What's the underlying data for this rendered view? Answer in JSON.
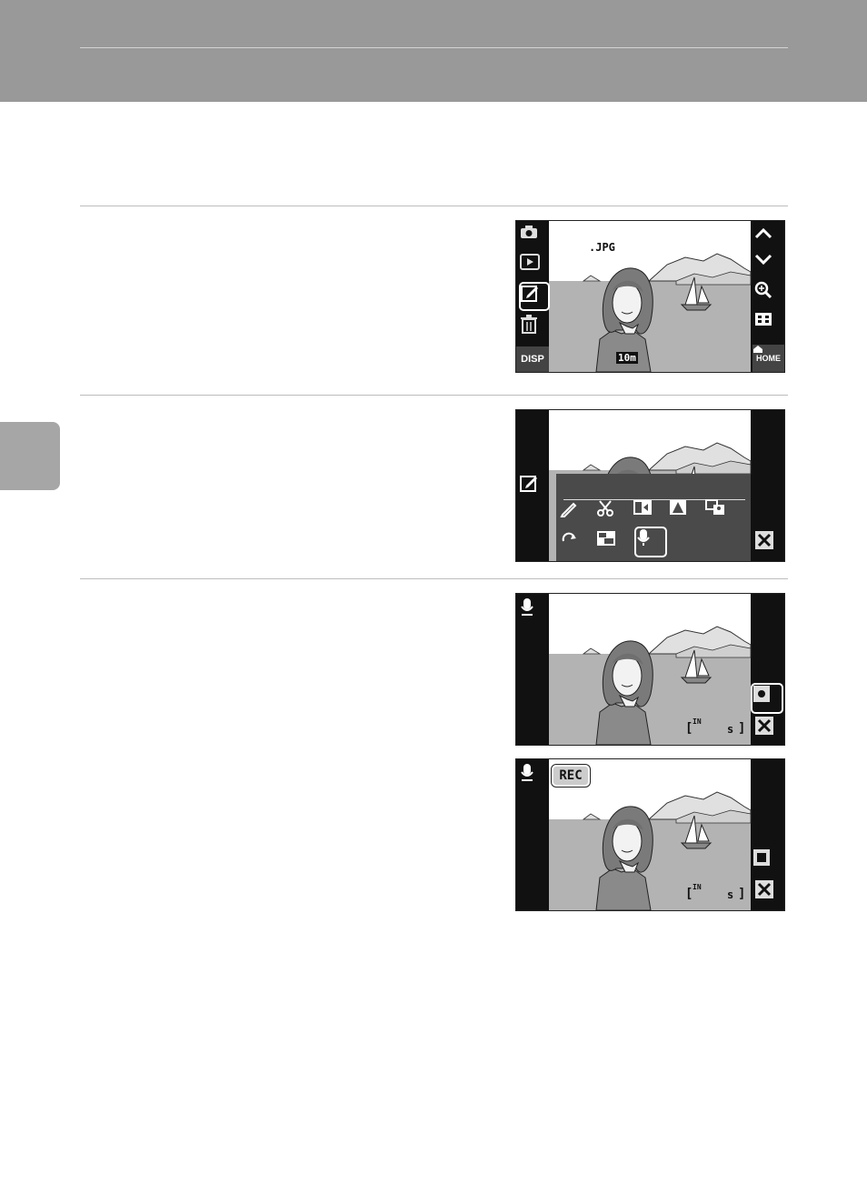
{
  "screens": {
    "step1": {
      "file_label": ".JPG",
      "size_badge": "10m",
      "disp_label": "DISP",
      "home_label": "HOME",
      "left_icons": [
        "shooting-mode-icon",
        "playback-mode-icon",
        "edit-icon",
        "delete-icon"
      ],
      "right_icons": [
        "up-arrow-icon",
        "down-arrow-icon",
        "zoom-icon",
        "thumbnail-icon"
      ]
    },
    "step2": {
      "menu_icons": [
        "paint-icon",
        "crop-icon",
        "d-lighting-icon",
        "skin-softening-icon",
        "small-picture-icon",
        "rotate-icon",
        "black-border-icon",
        "voice-memo-icon"
      ]
    },
    "step3a": {
      "memory_icon": "IN",
      "seconds_label": "s"
    },
    "step3b": {
      "rec_label": "REC",
      "memory_icon": "IN",
      "seconds_label": "s"
    }
  }
}
